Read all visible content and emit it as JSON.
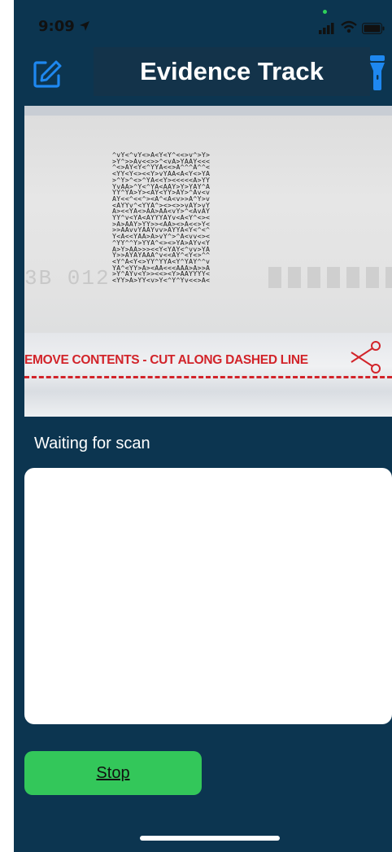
{
  "status_bar": {
    "time": "9:09",
    "icons": [
      "location-arrow-icon",
      "cellular-signal-icon",
      "wifi-icon",
      "battery-icon"
    ]
  },
  "header": {
    "title": "Evidence Track",
    "left_action_icon": "edit-icon",
    "right_action_icon": "flashlight-icon"
  },
  "camera": {
    "tape_text": "EMOVE CONTENTS - CUT ALONG DASHED LINE",
    "dim_text": "3B 012"
  },
  "scan": {
    "status_text": "Waiting for scan",
    "result_text": ""
  },
  "actions": {
    "stop_label": "Stop"
  },
  "colors": {
    "background": "#0c3550",
    "title_bar": "#13334a",
    "accent_blue": "#1e88f0",
    "stop_green": "#33c75a",
    "tape_red": "#d2242a"
  }
}
